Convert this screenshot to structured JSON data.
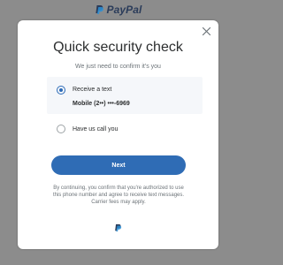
{
  "header": {
    "brand": "PayPal",
    "logo_icon": "paypal-logo-icon"
  },
  "modal": {
    "close_icon": "close-icon",
    "title": "Quick security check",
    "subtitle": "We just need to confirm it's you",
    "options": [
      {
        "label": "Receive a text",
        "detail": "Mobile (2••) •••-6969",
        "selected": true
      },
      {
        "label": "Have us call you",
        "selected": false
      }
    ],
    "next_label": "Next",
    "disclaimer": "By continuing, you confirm that you're authorized to use this phone number and agree to receive text messages. Carrier fees may apply.",
    "footer_icon": "paypal-monogram-icon"
  },
  "colors": {
    "backdrop": "#8c8c8c",
    "primary_button": "#2f6cb5",
    "selected_option_bg": "#f5f7fa",
    "brand_dark": "#2b3c5a",
    "brand_light": "#2c8fd6"
  }
}
